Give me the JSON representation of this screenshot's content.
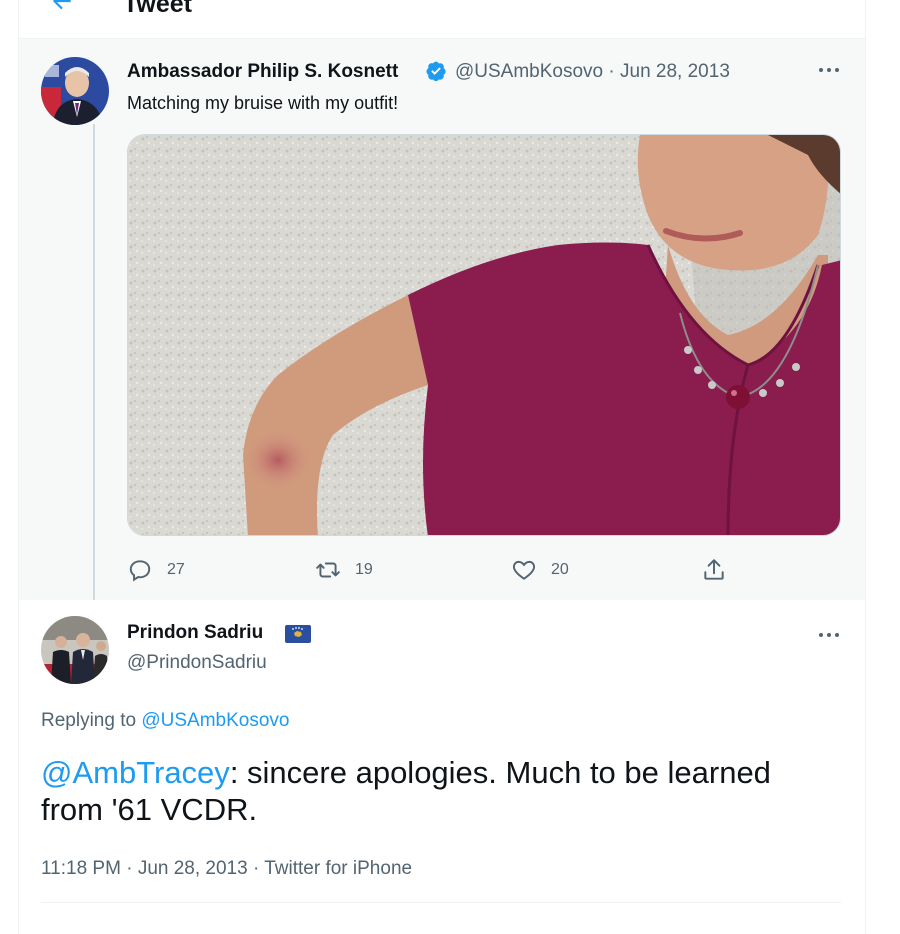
{
  "header": {
    "title": "Tweet"
  },
  "parent": {
    "name": "Ambassador Philip S. Kosnett",
    "handle": "@USAmbKosovo",
    "separator": "·",
    "date": "Jun 28, 2013",
    "text": "Matching my bruise with my outfit!",
    "actions": {
      "replies": "27",
      "retweets": "19",
      "likes": "20"
    }
  },
  "reply": {
    "name": "Prindon Sadriu",
    "handle": "@PrindonSadriu",
    "replying_prefix": "Replying to ",
    "replying_to": "@USAmbKosovo",
    "mention": "@AmbTracey",
    "text_line1": ": sincere apologies. Much to be learned",
    "text_line2": "from '61 VCDR.",
    "time": "11:18 PM",
    "date": "Jun 28, 2013",
    "source": "Twitter for iPhone"
  },
  "colors": {
    "accent": "#1d9bf0",
    "verified": "#1d9bf0",
    "muted": "#536471",
    "text": "#0f1419"
  }
}
